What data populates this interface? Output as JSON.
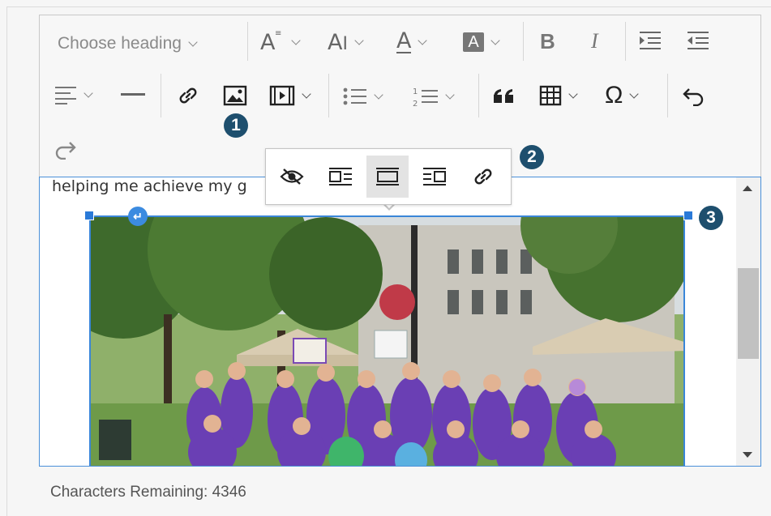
{
  "toolbar": {
    "heading_placeholder": "Choose heading",
    "font_size_glyph": "A",
    "font_family_glyph": "A",
    "font_color_glyph": "A",
    "bg_color_glyph": "A",
    "bold_glyph": "B",
    "italic_glyph": "I",
    "special_chars_glyph": "Ω"
  },
  "editor": {
    "visible_text": "helping me achieve my g"
  },
  "image_balloon": {
    "buttons": [
      "toggle-caption",
      "wrap-left",
      "wrap-center",
      "wrap-right",
      "link"
    ],
    "active": "wrap-center"
  },
  "markers": {
    "m1": "1",
    "m2": "2",
    "m3": "3"
  },
  "footer": {
    "characters_remaining": "Characters Remaining: 4346"
  },
  "colors": {
    "accent": "#3a86d8",
    "marker": "#1e4f6e",
    "photo_shirts": "#6a3fb4"
  }
}
